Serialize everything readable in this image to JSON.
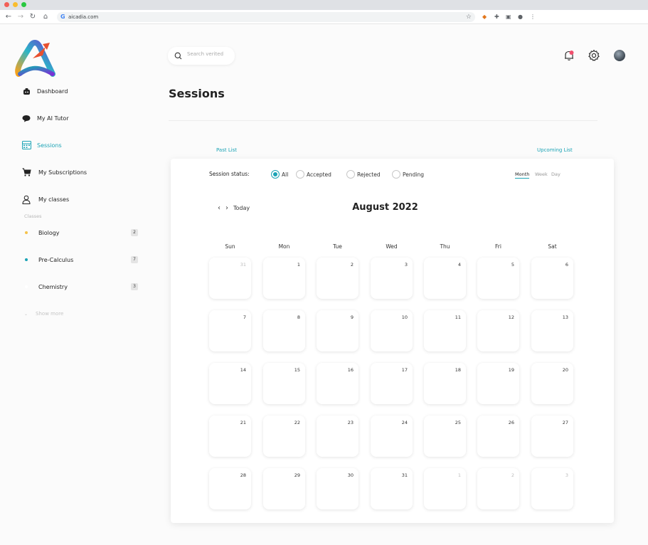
{
  "browser": {
    "url": "aicadia.com"
  },
  "sidebar": {
    "nav": [
      {
        "label": "Dashboard",
        "icon": "dashboard-icon"
      },
      {
        "label": "My AI Tutor",
        "icon": "chat-icon"
      },
      {
        "label": "Sessions",
        "icon": "sessions-icon",
        "active": true
      },
      {
        "label": "My Subscriptions",
        "icon": "cart-icon"
      },
      {
        "label": "My classes",
        "icon": "user-icon"
      }
    ],
    "classes_heading": "Classes",
    "classes": [
      {
        "name": "Biology",
        "count": "2",
        "color": "#f5c24b"
      },
      {
        "name": "Pre-Calculus",
        "count": "7",
        "color": "#1ba3b5"
      },
      {
        "name": "Chemistry",
        "count": "3",
        "color": "#ffffff"
      }
    ],
    "show_more": "Show more"
  },
  "header": {
    "search_placeholder": "Search verited"
  },
  "page": {
    "title": "Sessions",
    "past_list": "Past List",
    "upcoming_list": "Upcoming List"
  },
  "calendar": {
    "status_label": "Session status:",
    "statuses": [
      "All",
      "Accepted",
      "Rejected",
      "Pending"
    ],
    "selected_status": "All",
    "views": [
      "Month",
      "Week",
      "Day"
    ],
    "active_view": "Month",
    "today_label": "Today",
    "month_title": "August 2022",
    "weekdays": [
      "Sun",
      "Mon",
      "Tue",
      "Wed",
      "Thu",
      "Fri",
      "Sat"
    ],
    "weeks": [
      [
        "31",
        "1",
        "2",
        "3",
        "4",
        "5",
        "6"
      ],
      [
        "7",
        "8",
        "9",
        "10",
        "11",
        "12",
        "13"
      ],
      [
        "14",
        "15",
        "16",
        "17",
        "18",
        "19",
        "20"
      ],
      [
        "21",
        "22",
        "23",
        "24",
        "25",
        "26",
        "27"
      ],
      [
        "28",
        "29",
        "30",
        "31",
        "1",
        "2",
        "3"
      ]
    ],
    "muted_days": [
      [
        0,
        0
      ],
      [
        4,
        4
      ],
      [
        4,
        5
      ],
      [
        4,
        6
      ]
    ]
  },
  "colors": {
    "accent": "#1ba3b5"
  }
}
